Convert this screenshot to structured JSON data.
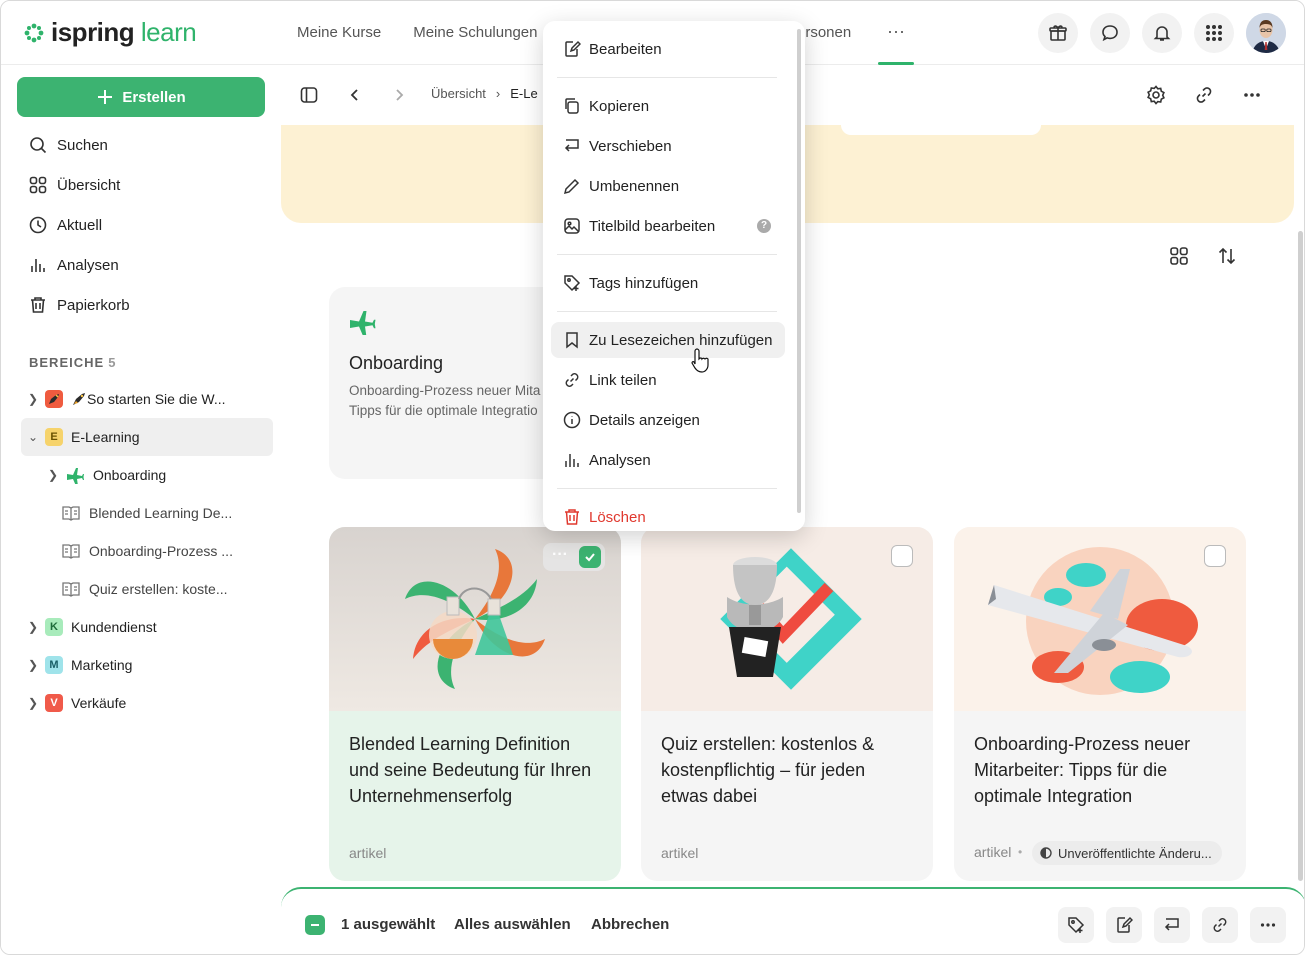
{
  "app": {
    "logo_a": "ispring",
    "logo_b": "learn",
    "accent": "#3cb371"
  },
  "topnav": {
    "items": [
      "Meine Kurse",
      "Meine Schulungen"
    ],
    "partial_item": "ersonen",
    "more_label": "···"
  },
  "sidebar": {
    "create_label": "Erstellen",
    "nav": [
      {
        "label": "Suchen",
        "icon": "search-icon"
      },
      {
        "label": "Übersicht",
        "icon": "grid-icon"
      },
      {
        "label": "Aktuell",
        "icon": "clock-icon"
      },
      {
        "label": "Analysen",
        "icon": "bar-chart-icon"
      },
      {
        "label": "Papierkorb",
        "icon": "trash-icon"
      }
    ],
    "section_title": "BEREICHE",
    "section_count": "5",
    "tree": [
      {
        "label": "So starten Sie die W...",
        "badge": "",
        "badge_color": "#ef5b3f"
      },
      {
        "label": "E-Learning",
        "badge": "E",
        "badge_color": "#f6d36b"
      },
      {
        "label": "Onboarding"
      },
      {
        "label": "Blended Learning De..."
      },
      {
        "label": "Onboarding-Prozess ..."
      },
      {
        "label": "Quiz erstellen: koste..."
      },
      {
        "label": "Kundendienst",
        "badge": "K",
        "badge_color": "#8fe0a6"
      },
      {
        "label": "Marketing",
        "badge": "M",
        "badge_color": "#7fd6e0"
      },
      {
        "label": "Verkäufe",
        "badge": "V",
        "badge_color": "#f05a4a"
      }
    ]
  },
  "breadcrumb": {
    "items": [
      "Übersicht",
      "E-Le"
    ]
  },
  "folder": {
    "title": "Onboarding",
    "desc_line1": "Onboarding-Prozess neuer Mita",
    "desc_line2": "Tipps für die optimale Integratio"
  },
  "cards": [
    {
      "title": "Blended Learning Definition und seine Bedeutung für Ihren Unternehmenserfolg",
      "type": "artikel",
      "selected": true
    },
    {
      "title": "Quiz erstellen: kostenlos & kostenpflichtig – für jeden etwas dabei",
      "type": "artikel",
      "selected": false
    },
    {
      "title": "Onboarding-Prozess neuer Mitarbeiter: Tipps für die optimale Integration",
      "type": "artikel",
      "selected": false,
      "status": "Unveröffentlichte Änderu..."
    }
  ],
  "menu": {
    "items": [
      {
        "label": "Bearbeiten",
        "icon": "edit-icon"
      },
      {
        "label": "Kopieren",
        "icon": "copy-icon"
      },
      {
        "label": "Verschieben",
        "icon": "move-icon"
      },
      {
        "label": "Umbenennen",
        "icon": "pencil-icon"
      },
      {
        "label": "Titelbild bearbeiten",
        "icon": "image-edit-icon"
      },
      {
        "label": "Tags hinzufügen",
        "icon": "tag-add-icon"
      },
      {
        "label": "Zu Lesezeichen hinzufügen",
        "icon": "bookmark-icon"
      },
      {
        "label": "Link teilen",
        "icon": "link-icon"
      },
      {
        "label": "Details anzeigen",
        "icon": "info-icon"
      },
      {
        "label": "Analysen",
        "icon": "bar-chart-icon"
      },
      {
        "label": "Löschen",
        "icon": "trash-icon"
      }
    ],
    "help": "?"
  },
  "bottombar": {
    "selected_count": "1 ausgewählt",
    "select_all": "Alles auswählen",
    "cancel": "Abbrechen"
  }
}
